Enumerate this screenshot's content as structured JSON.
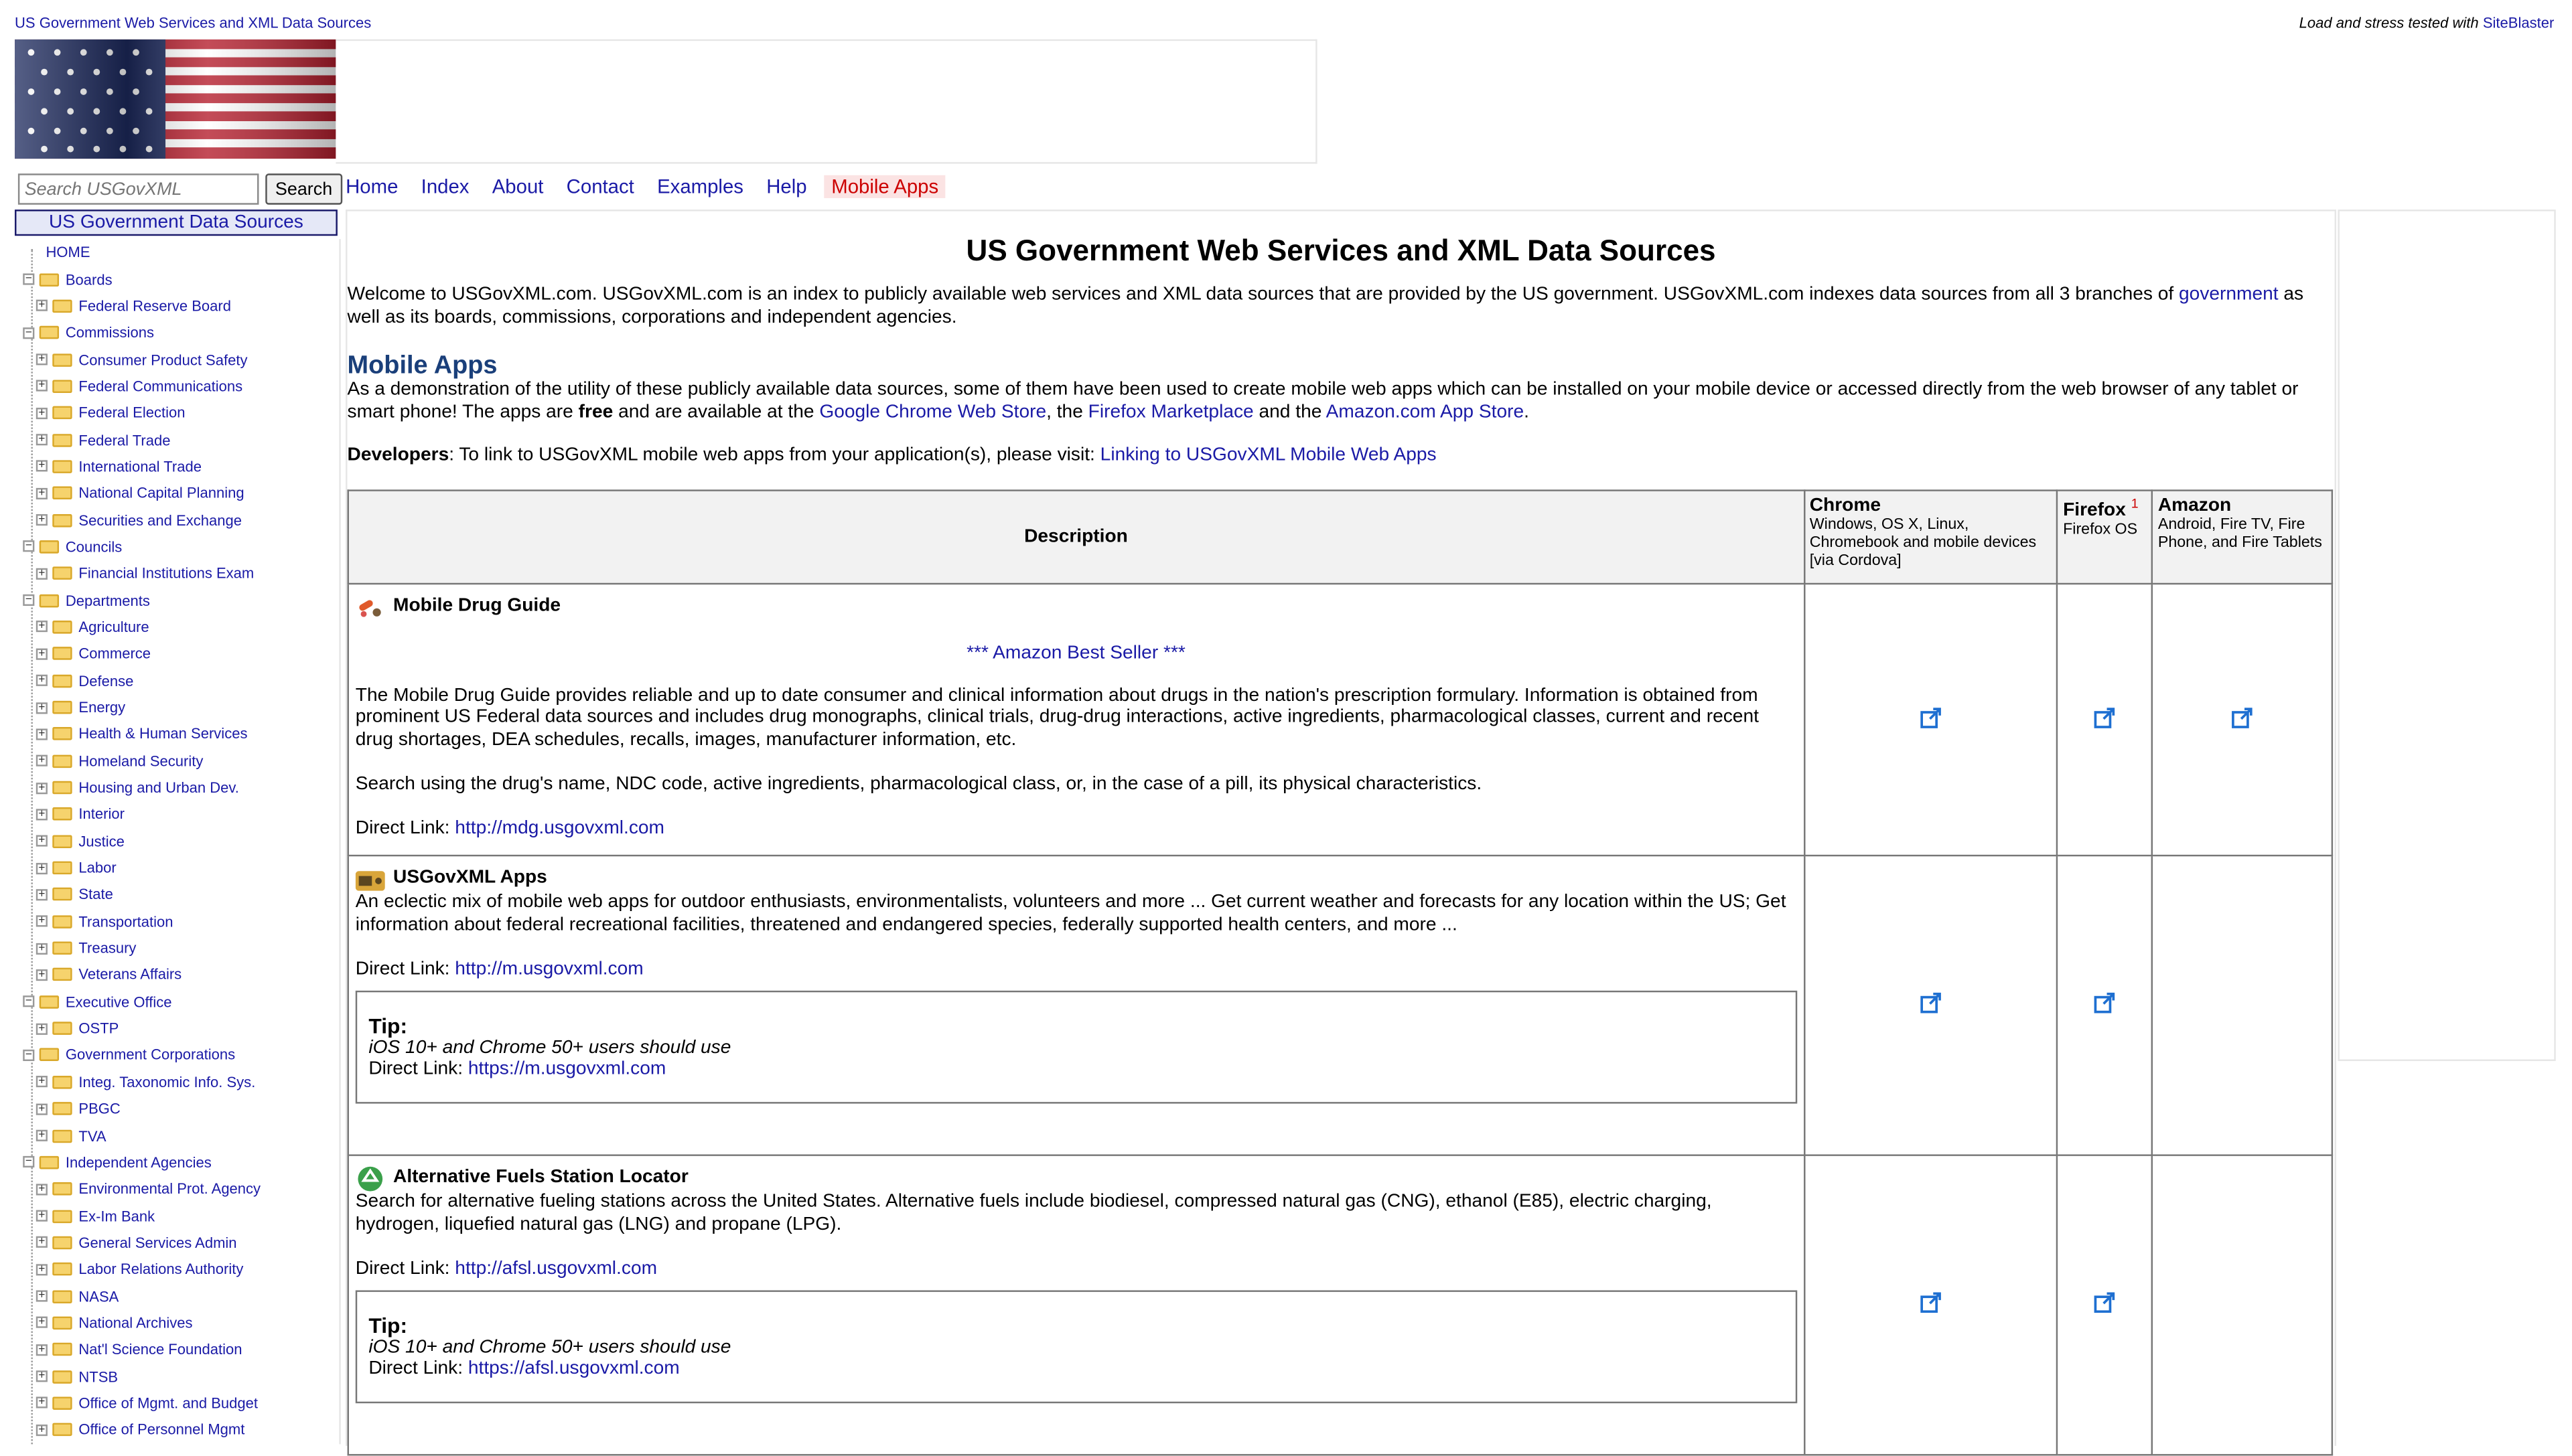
{
  "header": {
    "site_link": "US Government Web Services and XML Data Sources",
    "tested_text": "Load and stress tested with",
    "tested_link": "SiteBlaster"
  },
  "search": {
    "placeholder": "Search USGovXML",
    "button": "Search"
  },
  "nav": [
    "Home",
    "Index",
    "About",
    "Contact",
    "Examples",
    "Help",
    "Mobile Apps"
  ],
  "sidebar": {
    "title": "US Government Data Sources",
    "home": "HOME",
    "items": [
      {
        "label": "Boards",
        "level": 0
      },
      {
        "label": "Federal Reserve Board",
        "level": 1
      },
      {
        "label": "Commissions",
        "level": 0
      },
      {
        "label": "Consumer Product Safety",
        "level": 1
      },
      {
        "label": "Federal Communications",
        "level": 1
      },
      {
        "label": "Federal Election",
        "level": 1
      },
      {
        "label": "Federal Trade",
        "level": 1
      },
      {
        "label": "International Trade",
        "level": 1
      },
      {
        "label": "National Capital Planning",
        "level": 1
      },
      {
        "label": "Securities and Exchange",
        "level": 1
      },
      {
        "label": "Councils",
        "level": 0
      },
      {
        "label": "Financial Institutions Exam",
        "level": 1
      },
      {
        "label": "Departments",
        "level": 0
      },
      {
        "label": "Agriculture",
        "level": 1
      },
      {
        "label": "Commerce",
        "level": 1
      },
      {
        "label": "Defense",
        "level": 1
      },
      {
        "label": "Energy",
        "level": 1
      },
      {
        "label": "Health & Human Services",
        "level": 1
      },
      {
        "label": "Homeland Security",
        "level": 1
      },
      {
        "label": "Housing and Urban Dev.",
        "level": 1
      },
      {
        "label": "Interior",
        "level": 1
      },
      {
        "label": "Justice",
        "level": 1
      },
      {
        "label": "Labor",
        "level": 1
      },
      {
        "label": "State",
        "level": 1
      },
      {
        "label": "Transportation",
        "level": 1
      },
      {
        "label": "Treasury",
        "level": 1
      },
      {
        "label": "Veterans Affairs",
        "level": 1
      },
      {
        "label": "Executive Office",
        "level": 0
      },
      {
        "label": "OSTP",
        "level": 1
      },
      {
        "label": "Government Corporations",
        "level": 0
      },
      {
        "label": "Integ. Taxonomic Info. Sys.",
        "level": 1
      },
      {
        "label": "PBGC",
        "level": 1
      },
      {
        "label": "TVA",
        "level": 1
      },
      {
        "label": "Independent Agencies",
        "level": 0
      },
      {
        "label": "Environmental Prot. Agency",
        "level": 1
      },
      {
        "label": "Ex-Im Bank",
        "level": 1
      },
      {
        "label": "General Services Admin",
        "level": 1
      },
      {
        "label": "Labor Relations Authority",
        "level": 1
      },
      {
        "label": "NASA",
        "level": 1
      },
      {
        "label": "National Archives",
        "level": 1
      },
      {
        "label": "Nat'l Science Foundation",
        "level": 1
      },
      {
        "label": "NTSB",
        "level": 1
      },
      {
        "label": "Office of Mgmt. and Budget",
        "level": 1
      },
      {
        "label": "Office of Personnel Mgmt",
        "level": 1
      }
    ]
  },
  "main": {
    "title": "US Government Web Services and XML Data Sources",
    "welcome_1": "Welcome to USGovXML.com. USGovXML.com is an index to publicly available web services and XML data sources that are provided by the US government. USGovXML.com indexes data sources from all 3 branches of ",
    "welcome_link": "government",
    "welcome_2": " as well as its boards, commissions, corporations and independent agencies.",
    "mobile_heading": "Mobile Apps",
    "demo_1": "As a demonstration of the utility of these publicly available data sources, some of them have been used to create mobile web apps which can be installed on your mobile device or accessed directly from the web browser of any tablet or smart phone! The apps are ",
    "demo_free": "free",
    "demo_2": " and are available at the ",
    "demo_link1": "Google Chrome Web Store",
    "demo_3": ", the ",
    "demo_link2": "Firefox Marketplace",
    "demo_4": " and the ",
    "demo_link3": "Amazon.com App Store",
    "demo_5": ".",
    "dev_label": "Developers",
    "dev_text": ": To link to USGovXML mobile web apps from your application(s), please visit: ",
    "dev_link": "Linking to USGovXML Mobile Web Apps"
  },
  "table": {
    "desc_header": "Description",
    "chrome": {
      "name": "Chrome",
      "sub": "Windows, OS X, Linux, Chromebook and mobile devices [via Cordova]"
    },
    "firefox": {
      "name": "Firefox",
      "sup": "1",
      "sub": "Firefox OS"
    },
    "amazon": {
      "name": "Amazon",
      "sub": "Android, Fire TV, Fire Phone, and Fire Tablets"
    },
    "apps": [
      {
        "name": "Mobile Drug Guide",
        "badge": "*** Amazon Best Seller ***",
        "desc": "The Mobile Drug Guide provides reliable and up to date consumer and clinical information about drugs in the nation's prescription formulary. Information is obtained from prominent US Federal data sources and includes drug monographs, clinical trials, drug-drug interactions, active ingredients, pharmacological classes, current and recent drug shortages, DEA schedules, recalls, images, manufacturer information, etc.",
        "desc2": "Search using the drug's name, NDC code, active ingredients, pharmacological class, or, in the case of a pill, its physical characteristics.",
        "link_label": "Direct Link: ",
        "link": "http://mdg.usgovxml.com"
      },
      {
        "name": "USGovXML Apps",
        "desc": "An eclectic mix of mobile web apps for outdoor enthusiasts, environmentalists, volunteers and more ... Get current weather and forecasts for any location within the US; Get information about federal recreational facilities, threatened and endangered species, federally supported health centers, and more ...",
        "link_label": "Direct Link: ",
        "link": "http://m.usgovxml.com",
        "tip_title": "Tip:",
        "tip_text": "iOS 10+ and Chrome 50+ users should use",
        "tip_link_label": "Direct Link: ",
        "tip_link": "https://m.usgovxml.com"
      },
      {
        "name": "Alternative Fuels Station Locator",
        "desc": "Search for alternative fueling stations across the United States. Alternative fuels include biodiesel, compressed natural gas (CNG), ethanol (E85), electric charging, hydrogen, liquefied natural gas (LNG) and propane (LPG).",
        "link_label": "Direct Link: ",
        "link": "http://afsl.usgovxml.com",
        "tip_title": "Tip:",
        "tip_text": "iOS 10+ and Chrome 50+ users should use",
        "tip_link_label": "Direct Link: ",
        "tip_link": "https://afsl.usgovxml.com"
      }
    ]
  },
  "colors": {
    "link": "#1a1aa6",
    "heading": "#1a3f7a",
    "active_tab": "#c00000",
    "icon": "#1e6fd1"
  }
}
